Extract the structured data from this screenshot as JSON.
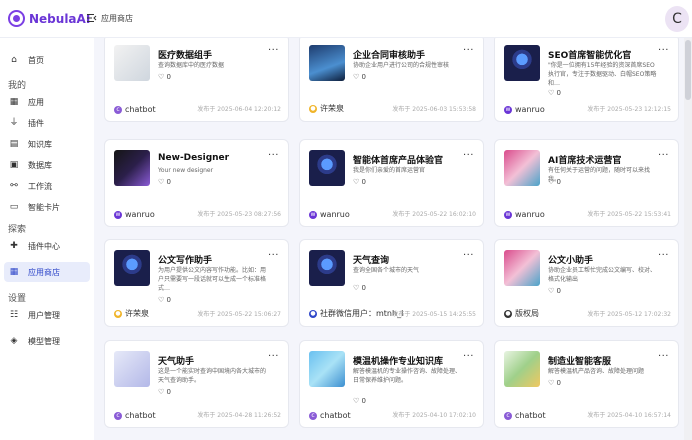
{
  "app": {
    "logo_text": "NebulaAI",
    "breadcrumb": "应用商店",
    "avatar_letter": "C"
  },
  "sidebar": {
    "home": "首页",
    "group_mine": "我的",
    "items_mine": [
      "应用",
      "插件",
      "知识库",
      "数据库",
      "工作流",
      "智能卡片"
    ],
    "group_explore": "探索",
    "items_explore": [
      "插件中心",
      "应用商店"
    ],
    "group_settings": "设置",
    "items_settings": [
      "用户管理",
      "模型管理"
    ]
  },
  "cards": [
    {
      "title": "医疗数据组手",
      "desc": "查询数据库中的医疗数据",
      "likes": "0",
      "user": "chatbot",
      "date": "发布于 2025-06-04 12:20:12"
    },
    {
      "title": "企业合同审核助手",
      "desc": "协助企业用户进行公司的合规性审核",
      "likes": "0",
      "user": "许荣泉",
      "date": "发布于 2025-06-03 15:53:58"
    },
    {
      "title": "SEO首席智能优化官",
      "desc": "\"你是一位拥有15年经验的资深首席SEO执行官，专注于数据驱动、白帽SEO策略和…",
      "likes": "0",
      "user": "wanruo",
      "date": "发布于 2025-05-23 12:12:15"
    },
    {
      "title": "New-Designer",
      "desc": "Your new designer",
      "likes": "0",
      "user": "wanruo",
      "date": "发布于 2025-05-23 08:27:56"
    },
    {
      "title": "智能体首席产品体验官",
      "desc": "我是你们亲爱的首席运营官",
      "likes": "0",
      "user": "wanruo",
      "date": "发布于 2025-05-22 16:02:10"
    },
    {
      "title": "AI首席技术运营官",
      "desc": "有任何关于运营的问题，随时可以来找我。",
      "likes": "0",
      "user": "wanruo",
      "date": "发布于 2025-05-22 15:53:41"
    },
    {
      "title": "公文写作助手",
      "desc": "为用户提供公文内容写作功能。比如：用户只需要写一段话就可以生成一个标准格式…",
      "likes": "0",
      "user": "许荣泉",
      "date": "发布于 2025-05-22 15:06:27"
    },
    {
      "title": "天气查询",
      "desc": "查询全国各个城市的天气",
      "likes": "0",
      "user": "社群微信用户：mtnh_l",
      "date": "发布于 2025-05-15 14:25:55"
    },
    {
      "title": "公文小助手",
      "desc": "协助企业员工帮忙完成公文编写、校对、格式化输出",
      "likes": "0",
      "user": "版权局",
      "date": "发布于 2025-05-12 17:02:32"
    },
    {
      "title": "天气助手",
      "desc": "这是一个能实时查询中国境内各大城市的天气查询助手。",
      "likes": "0",
      "user": "chatbot",
      "date": "发布于 2025-04-28 11:26:52"
    },
    {
      "title": "模温机操作专业知识库",
      "desc": "解答模温机的专业操作咨询、故障处理、日常保养维护问题。",
      "likes": "0",
      "user": "chatbot",
      "date": "发布于 2025-04-10 17:02:10"
    },
    {
      "title": "制造业智能客服",
      "desc": "解答模温机产品咨询、故障处理问题",
      "likes": "0",
      "user": "chatbot",
      "date": "发布于 2025-04-10 16:57:14"
    }
  ]
}
